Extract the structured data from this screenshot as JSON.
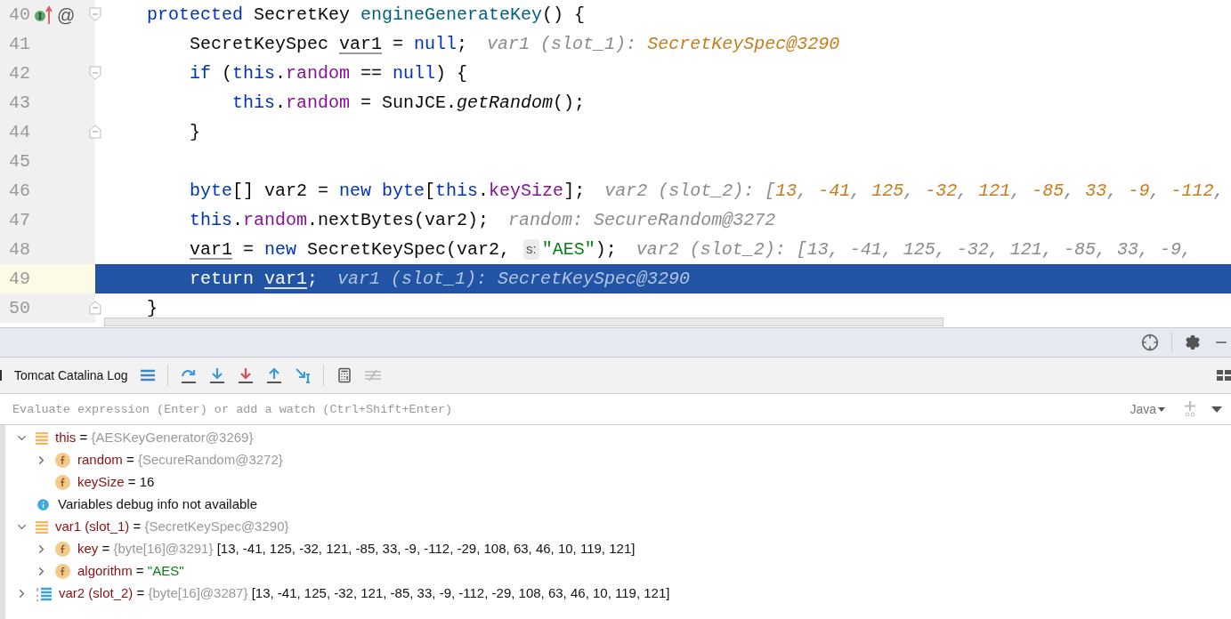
{
  "editor": {
    "lines": [
      {
        "number": "40",
        "selected": false,
        "fold_start": true,
        "gutter_glyph": "@",
        "tokens": [
          {
            "kind": "keyword",
            "text": "protected "
          },
          {
            "kind": "plain",
            "text": "SecretKey "
          },
          {
            "kind": "declaration",
            "text": "engineGenerateKey"
          },
          {
            "kind": "plain",
            "text": "() {"
          }
        ],
        "children": [
          {
            "number": "41",
            "selected": false,
            "tokens": [
              {
                "kind": "plain",
                "text": "SecretKeySpec "
              },
              {
                "kind": "local",
                "text": "var1"
              },
              {
                "kind": "plain",
                "text": " = "
              },
              {
                "kind": "keyword",
                "text": "null"
              },
              {
                "kind": "plain",
                "text": ";"
              }
            ],
            "hint": [
              {
                "kind": "hint",
                "text": "var1 (slot_1): "
              },
              {
                "kind": "hint_value",
                "text": "SecretKeySpec@3290"
              }
            ]
          },
          {
            "number": "42",
            "selected": false,
            "fold_start": true,
            "tokens": [
              {
                "kind": "keyword",
                "text": "if "
              },
              {
                "kind": "plain",
                "text": "("
              },
              {
                "kind": "keyword",
                "text": "this"
              },
              {
                "kind": "plain",
                "text": "."
              },
              {
                "kind": "field",
                "text": "random"
              },
              {
                "kind": "plain",
                "text": " == "
              },
              {
                "kind": "keyword",
                "text": "null"
              },
              {
                "kind": "plain",
                "text": ") {"
              }
            ],
            "children": [
              {
                "number": "43",
                "selected": false,
                "tokens": [
                  {
                    "kind": "keyword",
                    "text": "this"
                  },
                  {
                    "kind": "plain",
                    "text": "."
                  },
                  {
                    "kind": "field",
                    "text": "random"
                  },
                  {
                    "kind": "plain",
                    "text": " = SunJCE."
                  },
                  {
                    "kind": "method",
                    "text": "getRandom"
                  },
                  {
                    "kind": "plain",
                    "text": "();"
                  }
                ]
              }
            ]
          },
          {
            "number": "44",
            "selected": false,
            "fold_end": true,
            "tokens": [
              {
                "kind": "plain",
                "text": "}"
              }
            ]
          },
          {
            "number": "45",
            "selected": false
          },
          {
            "number": "46",
            "selected": false,
            "tokens": [
              {
                "kind": "keyword",
                "text": "byte"
              },
              {
                "kind": "plain",
                "text": "[] var2 = "
              },
              {
                "kind": "keyword",
                "text": "new byte"
              },
              {
                "kind": "plain",
                "text": "["
              },
              {
                "kind": "keyword",
                "text": "this"
              },
              {
                "kind": "plain",
                "text": "."
              },
              {
                "kind": "field",
                "text": "keySize"
              },
              {
                "kind": "plain",
                "text": "];"
              }
            ],
            "hint": [
              {
                "kind": "hint",
                "text": "var2 (slot_2): ["
              },
              {
                "kind": "hint_value",
                "text": "13"
              },
              {
                "kind": "hint",
                "text": ", "
              },
              {
                "kind": "hint_value",
                "text": "-41"
              },
              {
                "kind": "hint",
                "text": ", "
              },
              {
                "kind": "hint_value",
                "text": "125"
              },
              {
                "kind": "hint",
                "text": ", "
              },
              {
                "kind": "hint_value",
                "text": "-32"
              },
              {
                "kind": "hint",
                "text": ", "
              },
              {
                "kind": "hint_value",
                "text": "121"
              },
              {
                "kind": "hint",
                "text": ", "
              },
              {
                "kind": "hint_value",
                "text": "-85"
              },
              {
                "kind": "hint",
                "text": ", "
              },
              {
                "kind": "hint_value",
                "text": "33"
              },
              {
                "kind": "hint",
                "text": ", "
              },
              {
                "kind": "hint_value",
                "text": "-9"
              },
              {
                "kind": "hint",
                "text": ", "
              },
              {
                "kind": "hint_value",
                "text": "-112"
              },
              {
                "kind": "hint",
                "text": ","
              }
            ]
          },
          {
            "number": "47",
            "selected": false,
            "tokens": [
              {
                "kind": "keyword",
                "text": "this"
              },
              {
                "kind": "plain",
                "text": "."
              },
              {
                "kind": "field",
                "text": "random"
              },
              {
                "kind": "plain",
                "text": ".nextBytes(var2);"
              }
            ],
            "hint": [
              {
                "kind": "hint",
                "text": "random: SecureRandom@3272"
              }
            ]
          },
          {
            "number": "48",
            "selected": false,
            "tokens": [
              {
                "kind": "local",
                "text": "var1"
              },
              {
                "kind": "plain",
                "text": " = "
              },
              {
                "kind": "keyword",
                "text": "new "
              },
              {
                "kind": "plain",
                "text": "SecretKeySpec(var2, "
              },
              {
                "kind": "param_hint",
                "text": "s:"
              },
              {
                "kind": "string",
                "text": "\"AES\""
              },
              {
                "kind": "plain",
                "text": ");"
              }
            ],
            "hint": [
              {
                "kind": "hint",
                "text": "var2 (slot_2): [13, -41, 125, -32, 121, -85, 33, -9,"
              }
            ]
          },
          {
            "number": "49",
            "selected": true,
            "tokens": [
              {
                "kind": "keyword",
                "text": "return "
              },
              {
                "kind": "local",
                "text": "var1"
              },
              {
                "kind": "plain",
                "text": ";"
              }
            ],
            "hint": [
              {
                "kind": "hint",
                "text": "var1 (slot_1): SecretKeySpec@3290"
              }
            ]
          }
        ]
      },
      {
        "number": "50",
        "selected": false,
        "fold_end": true,
        "tokens": [
          {
            "kind": "plain",
            "text": "}"
          }
        ]
      }
    ]
  },
  "debugger": {
    "tab": "Tomcat Catalina Log",
    "evaluate": {
      "placeholder": "Evaluate expression (Enter) or add a watch (Ctrl+Shift+Enter)",
      "language": "Java"
    },
    "variables": [
      {
        "kind": "object",
        "name": "this",
        "equals": "=",
        "ref": "{AESKeyGenerator@3269}",
        "expanded": true,
        "children": [
          {
            "kind": "field",
            "name": "random",
            "equals": "=",
            "ref": "{SecureRandom@3272}",
            "expanded": false
          },
          {
            "kind": "field",
            "name": "keySize",
            "equals": "=",
            "value": {
              "kind": "plain",
              "text": "16"
            }
          }
        ]
      },
      {
        "kind": "info",
        "name": "Variables debug info not available"
      },
      {
        "kind": "object",
        "name": "var1 (slot_1)",
        "equals": "=",
        "ref": "{SecretKeySpec@3290}",
        "expanded": true,
        "children": [
          {
            "kind": "field",
            "name": "key",
            "equals": "=",
            "ref": "{byte[16]@3291}",
            "value": {
              "kind": "plain",
              "text": "[13, -41, 125, -32, 121, -85, 33, -9, -112, -29, 108, 63, 46, 10, 119, 121]"
            },
            "expanded": false
          },
          {
            "kind": "field",
            "name": "algorithm",
            "equals": "=",
            "value": {
              "kind": "string",
              "text": "\"AES\""
            },
            "expanded": false
          }
        ]
      },
      {
        "kind": "array",
        "name": "var2 (slot_2)",
        "equals": "=",
        "ref": "{byte[16]@3287}",
        "value": {
          "kind": "plain",
          "text": "[13, -41, 125, -32, 121, -85, 33, -9, -112, -29, 108, 63, 46, 10, 119, 121]"
        },
        "expanded": false
      }
    ]
  }
}
